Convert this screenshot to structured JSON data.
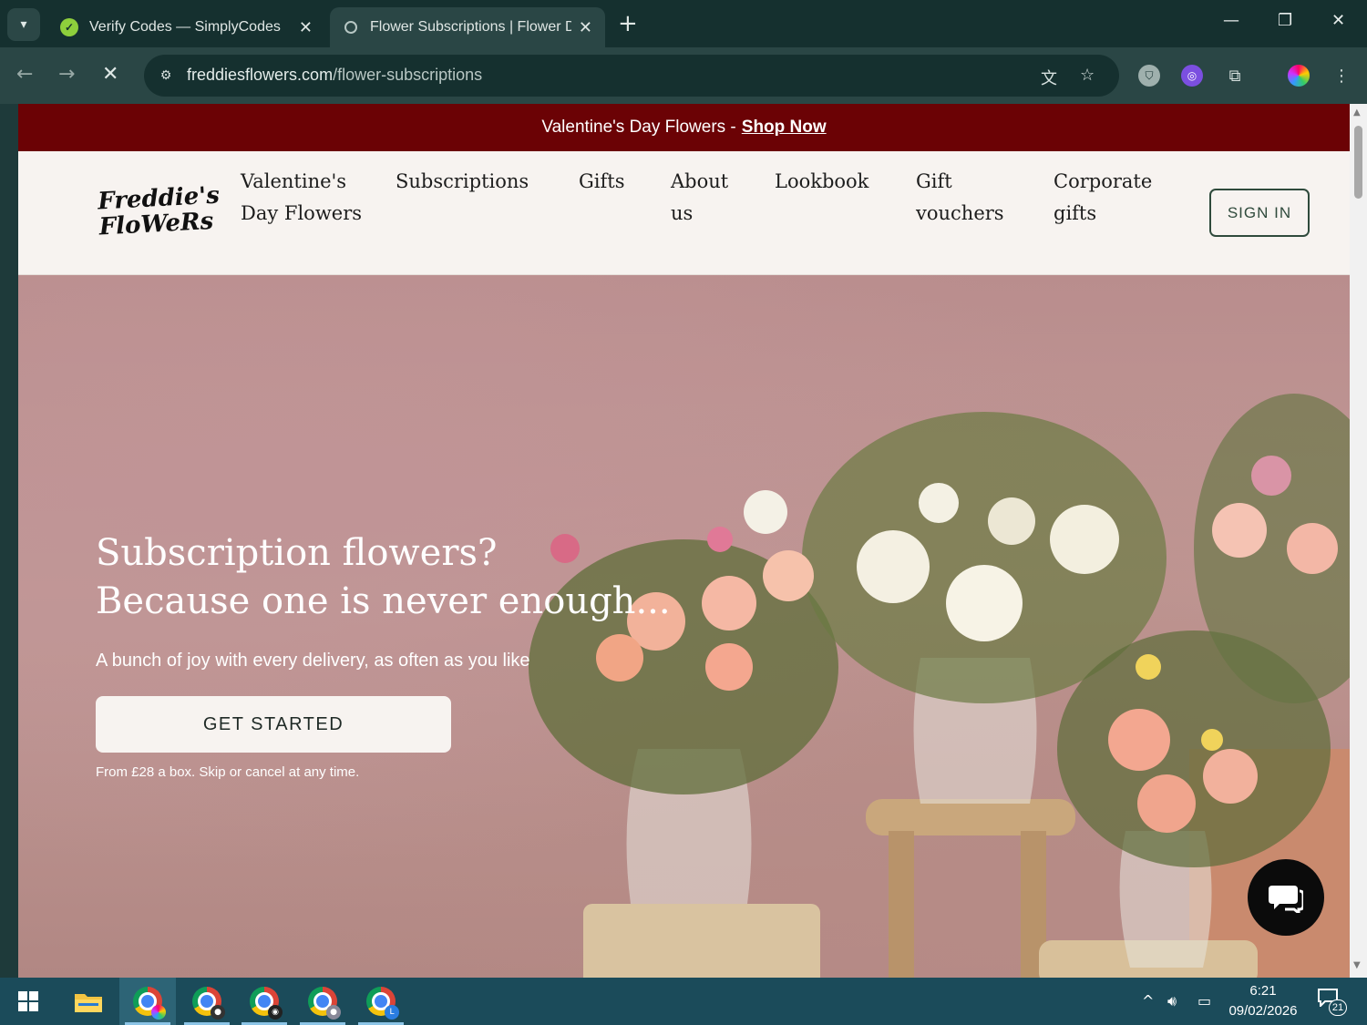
{
  "browser": {
    "tabs": [
      {
        "title": "Verify Codes — SimplyCodes",
        "favicon": "simplycodes-check-icon",
        "active": false
      },
      {
        "title": "Flower Subscriptions | Flower D",
        "favicon": "globe-icon",
        "active": true
      }
    ],
    "url_domain": "freddiesflowers.com",
    "url_path": "/flower-subscriptions"
  },
  "page": {
    "promo": {
      "text": "Valentine's Day Flowers - ",
      "link": "Shop Now",
      "background": "#6b0205"
    },
    "logo": {
      "line1": "Freddie's",
      "line2": "FloWeRs"
    },
    "nav": [
      {
        "label": "Valentine's Day Flowers"
      },
      {
        "label": "Subscriptions"
      },
      {
        "label": "Gifts"
      },
      {
        "label": "About us"
      },
      {
        "label": "Lookbook"
      },
      {
        "label": "Gift vouchers"
      },
      {
        "label": "Corporate gifts"
      }
    ],
    "signin": "SIGN IN",
    "hero": {
      "title_line1": "Subscription flowers?",
      "title_line2": "Because one is never enough...",
      "subtitle": "A bunch of joy with every delivery, as often as you like",
      "cta": "GET STARTED",
      "note": "From £28 a box. Skip or cancel at any time."
    },
    "accent": "#2f4a3c"
  },
  "taskbar": {
    "clock_time": "6:21",
    "clock_date": "09/02/2026",
    "notification_count": "21",
    "apps": [
      "windows-start",
      "file-explorer",
      "chrome-profile-1",
      "chrome-profile-2",
      "chrome-profile-3",
      "chrome-profile-4",
      "chrome-profile-5"
    ]
  }
}
